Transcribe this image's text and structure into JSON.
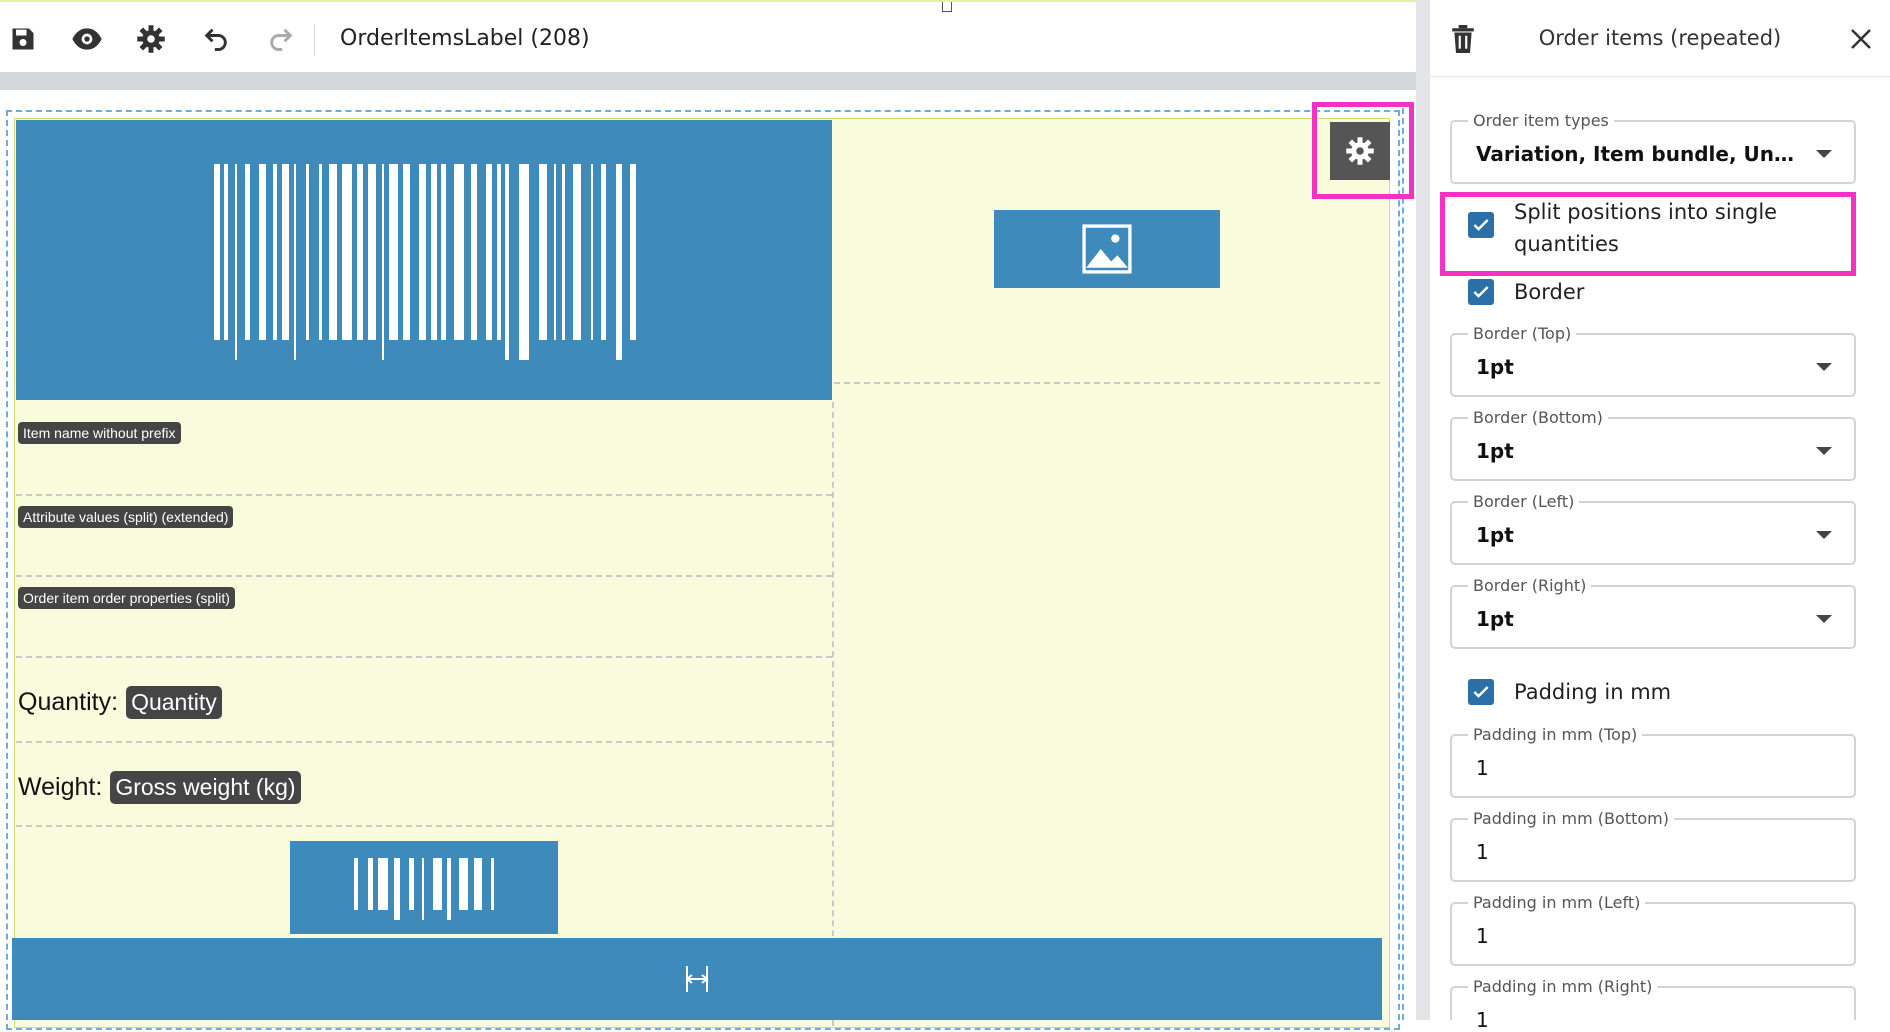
{
  "toolbar": {
    "document_title": "OrderItemsLabel (208)",
    "icons": [
      "save-icon",
      "eye-icon",
      "gear-icon",
      "undo-icon",
      "redo-icon"
    ]
  },
  "canvas": {
    "chips": {
      "item_name": "Item name without prefix",
      "attribute_values": "Attribute values (split) (extended)",
      "order_properties": "Order item order properties (split)"
    },
    "quantity_label": "Quantity:",
    "quantity_chip": "Quantity",
    "weight_label": "Weight:",
    "weight_chip": "Gross weight (kg)"
  },
  "panel": {
    "title": "Order items (repeated)",
    "order_item_types": {
      "label": "Order item types",
      "value": "Variation, Item bundle, Unassig..."
    },
    "split_positions": {
      "label": "Split positions into single quantities",
      "checked": true
    },
    "border": {
      "label": "Border",
      "checked": true
    },
    "border_top": {
      "label": "Border (Top)",
      "value": "1pt"
    },
    "border_bottom": {
      "label": "Border (Bottom)",
      "value": "1pt"
    },
    "border_left": {
      "label": "Border (Left)",
      "value": "1pt"
    },
    "border_right": {
      "label": "Border (Right)",
      "value": "1pt"
    },
    "padding_mm": {
      "label": "Padding in mm",
      "checked": true
    },
    "padding_top": {
      "label": "Padding in mm (Top)",
      "value": "1"
    },
    "padding_bottom": {
      "label": "Padding in mm (Bottom)",
      "value": "1"
    },
    "padding_left": {
      "label": "Padding in mm (Left)",
      "value": "1"
    },
    "padding_right": {
      "label": "Padding in mm (Right)",
      "value": "1"
    }
  },
  "colors": {
    "accent_blue": "#3e8bbb",
    "label_background": "#f8fcdc",
    "highlight_magenta": "#f431c5",
    "checkbox_blue": "#2b6fa8"
  }
}
